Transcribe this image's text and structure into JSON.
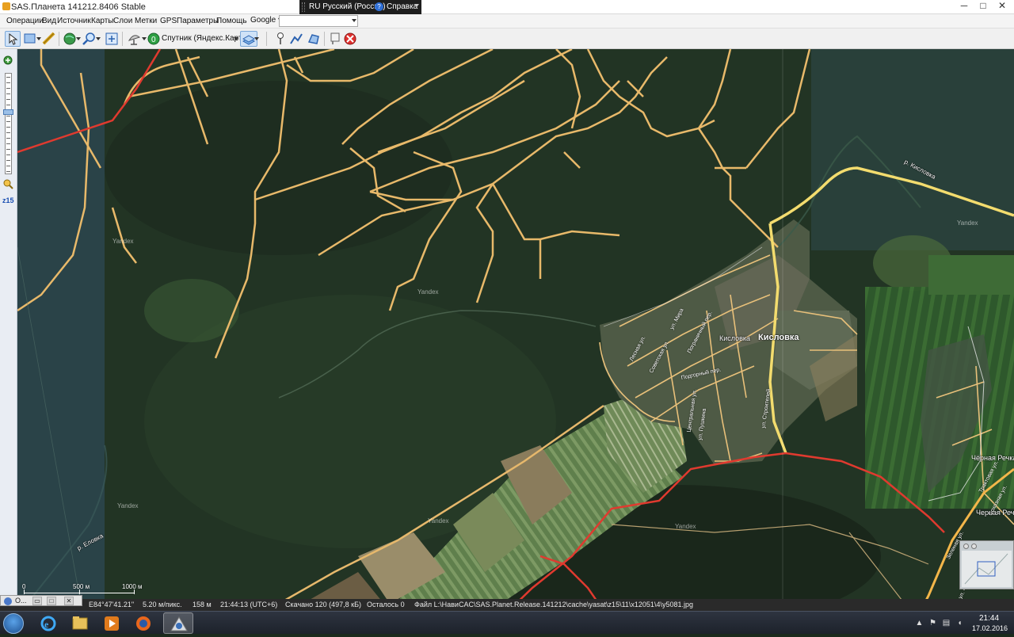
{
  "window": {
    "title": "SAS.Планета 141212.8406 Stable",
    "language_bar": {
      "language": "RU Русский (Россия)",
      "help": "Справка"
    },
    "controls": {
      "minimize": "─",
      "maximize": "□",
      "close": "✕"
    }
  },
  "menu": {
    "items": [
      "Операции",
      "Вид",
      "Источник",
      "Карты",
      "Слои",
      "Метки",
      "GPS",
      "Параметры",
      "Помощь"
    ],
    "map_source": "Google ▾",
    "search_placeholder": ""
  },
  "toolbar": {
    "map_name": "Спутник (Яндекс.Карты)",
    "icons": [
      "select-arrow-icon",
      "select-rect-icon",
      "ruler-icon",
      "globe-icon",
      "zoom-icon",
      "fullscreen-icon",
      "satellite-dish-icon",
      "map-source-icon",
      "layers-icon",
      "placemark-icon",
      "path-icon",
      "polygon-icon",
      "marks-icon",
      "delete-icon"
    ]
  },
  "zoom": {
    "level": "z15"
  },
  "map": {
    "town_label": "Кисловка",
    "town_label_small": "Кисловка",
    "village_label": "Чёрная Речка",
    "village_label_2": "Черная Речка",
    "river_1": "р. Кисловка",
    "river_2": "р. Еловка",
    "watermark": "Yandex",
    "streets": [
      "ул. Строителей",
      "Советская ул.",
      "Лесная ул.",
      "Пограничный пер.",
      "ул. Мира",
      "Подгорный пер.",
      "Центральная ул.",
      "ул. Пушкина",
      "Трактовая ул.",
      "Сохозная ул.",
      "Зеленая ул.",
      "ул. Чернышевского"
    ]
  },
  "scale": {
    "small": "500 м",
    "large": "1000 м",
    "zero": "0"
  },
  "status": {
    "window_mini_title": "O...",
    "coords": "E84°47'41.21\"",
    "resolution": "5.20 м/пикс.",
    "altitude": "158 м",
    "time": "21:44:13 (UTC+6)",
    "downloaded": "Скачано 120 (497,8 кБ)",
    "remaining": "Осталось 0",
    "file": "Файл L:\\НавиCAC\\SAS.Planet.Release.141212\\cache\\yasat\\z15\\11\\x12051\\4\\y5081.jpg"
  },
  "taskbar": {
    "time": "21:44",
    "date": "17.02.2016",
    "apps": [
      "ie-icon",
      "explorer-icon",
      "media-player-icon",
      "firefox-icon",
      "sasplanet-icon"
    ]
  },
  "colors": {
    "road_minor": "#e9b96e",
    "road_major": "#f3dc6e",
    "boundary": "#e03a2f",
    "forest_dark": "#1f2f21",
    "forest": "#2a3d2a",
    "field": "#5d7a4a"
  }
}
